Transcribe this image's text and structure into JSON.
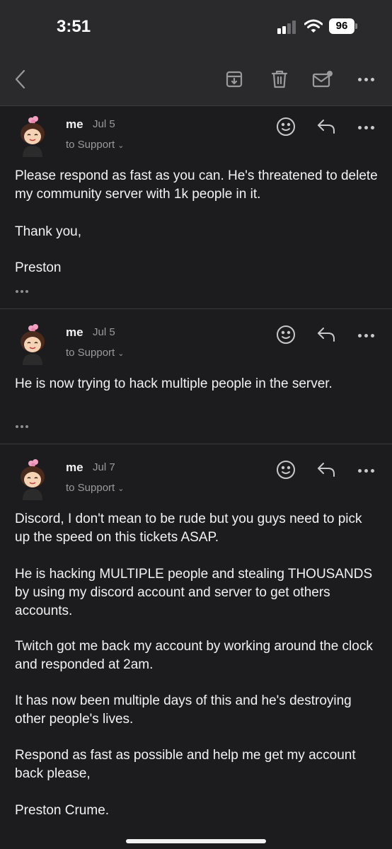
{
  "status_bar": {
    "time": "3:51",
    "battery": "96"
  },
  "toolbar": {
    "back_icon": "chevron-left-icon",
    "archive_icon": "archive-icon",
    "trash_icon": "trash-icon",
    "mark_unread_icon": "mail-unread-icon",
    "more_icon": "more-horizontal-icon"
  },
  "messages": [
    {
      "sender": "me",
      "date": "Jul 5",
      "to": "to Support",
      "paragraphs": [
        "Please respond as fast as you can. He's threatened to delete my community server with 1k people in it.",
        "Thank you,",
        "Preston"
      ]
    },
    {
      "sender": "me",
      "date": "Jul 5",
      "to": "to Support",
      "paragraphs": [
        "He is now trying to hack multiple people in the server."
      ]
    },
    {
      "sender": "me",
      "date": "Jul 7",
      "to": "to Support",
      "paragraphs": [
        "Discord, I don't mean to be rude but you guys need to pick up the speed on this tickets ASAP.",
        "He is hacking MULTIPLE people and stealing THOUSANDS by using my discord account and server to get others accounts.",
        "Twitch got me back my account by working around the clock and responded at 2am.",
        "It has now been multiple days of this and he's destroying other people's lives.",
        "Respond as fast as possible and help me get my account back please,",
        "Preston Crume."
      ]
    }
  ],
  "colors": {
    "background": "#1c1c1e",
    "toolbar": "#2a2a2c",
    "divider": "#3a3a3c",
    "secondary_text": "#9a9a9e"
  }
}
